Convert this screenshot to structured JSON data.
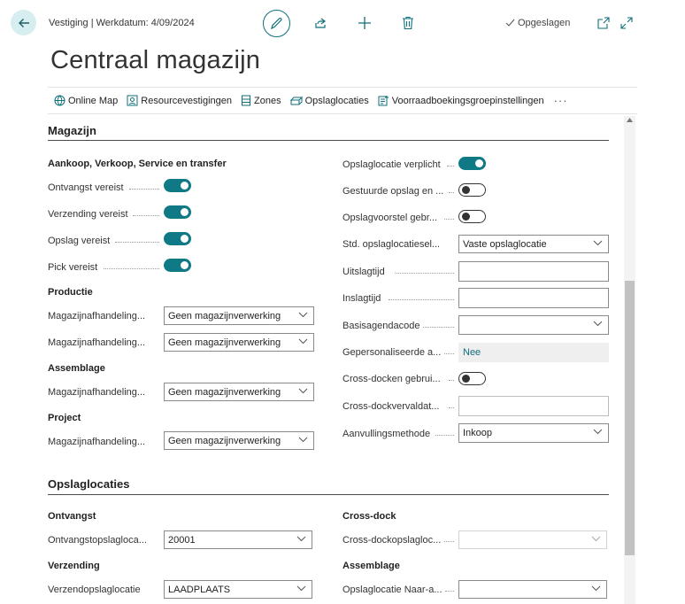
{
  "header": {
    "breadcrumb": "Vestiging | Werkdatum: 4/09/2024",
    "saved_status": "Opgeslagen"
  },
  "page": {
    "title": "Centraal magazijn"
  },
  "actions": [
    {
      "label": "Online Map"
    },
    {
      "label": "Resourcevestigingen"
    },
    {
      "label": "Zones"
    },
    {
      "label": "Opslaglocaties"
    },
    {
      "label": "Voorraadboekingsgroepinstellingen"
    }
  ],
  "more_label": "···",
  "magazijn": {
    "title": "Magazijn",
    "left": {
      "group_aankoop": "Aankoop, Verkoop, Service en transfer",
      "ontvangst_label": "Ontvangst vereist",
      "ontvangst_value": true,
      "verzending_label": "Verzending vereist",
      "verzending_value": true,
      "opslag_label": "Opslag vereist",
      "opslag_value": true,
      "pick_label": "Pick vereist",
      "pick_value": true,
      "group_productie": "Productie",
      "prod1_label": "Magazijnafhandeling...",
      "prod1_value": "Geen magazijnverwerking",
      "prod2_label": "Magazijnafhandeling...",
      "prod2_value": "Geen magazijnverwerking",
      "group_assemblage": "Assemblage",
      "asm_label": "Magazijnafhandeling...",
      "asm_value": "Geen magazijnverwerking",
      "group_project": "Project",
      "proj_label": "Magazijnafhandeling...",
      "proj_value": "Geen magazijnverwerking"
    },
    "right": {
      "opslagloc_verplicht_label": "Opslaglocatie verplicht",
      "opslagloc_verplicht_value": true,
      "gestuurde_label": "Gestuurde opslag en ...",
      "gestuurde_value": false,
      "opslagvoorstel_label": "Opslagvoorstel gebr...",
      "opslagvoorstel_value": false,
      "std_label": "Std. opslaglocatiesel...",
      "std_value": "Vaste opslaglocatie",
      "uitslag_label": "Uitslagtijd",
      "uitslag_value": "",
      "inslag_label": "Inslagtijd",
      "inslag_value": "",
      "basisagenda_label": "Basisagendacode",
      "basisagenda_value": "",
      "gepersonaliseerde_label": "Gepersonaliseerde a...",
      "gepersonaliseerde_value": "Nee",
      "crossdock_gebr_label": "Cross-docken gebrui...",
      "crossdock_gebr_value": false,
      "crossdock_verval_label": "Cross-dockvervaldat...",
      "crossdock_verval_value": "",
      "aanvulling_label": "Aanvullingsmethode",
      "aanvulling_value": "Inkoop"
    }
  },
  "opslaglocaties": {
    "title": "Opslaglocaties",
    "left": {
      "group_ontvangst": "Ontvangst",
      "ontvangst_label": "Ontvangstopslaglоca...",
      "ontvangst_value": "20001",
      "group_verzending": "Verzending",
      "verzending_label": "Verzendopslaglocatie",
      "verzending_value": "LAADPLAATS"
    },
    "right": {
      "group_crossdock": "Cross-dock",
      "crossdock_label": "Cross-dockopslagloc...",
      "crossdock_value": "",
      "group_assemblage": "Assemblage",
      "naar_label": "Opslaglocatie Naar-a...",
      "naar_value": ""
    }
  },
  "colors": {
    "accent": "#0f7a85",
    "back_bg": "#d6eef0"
  }
}
